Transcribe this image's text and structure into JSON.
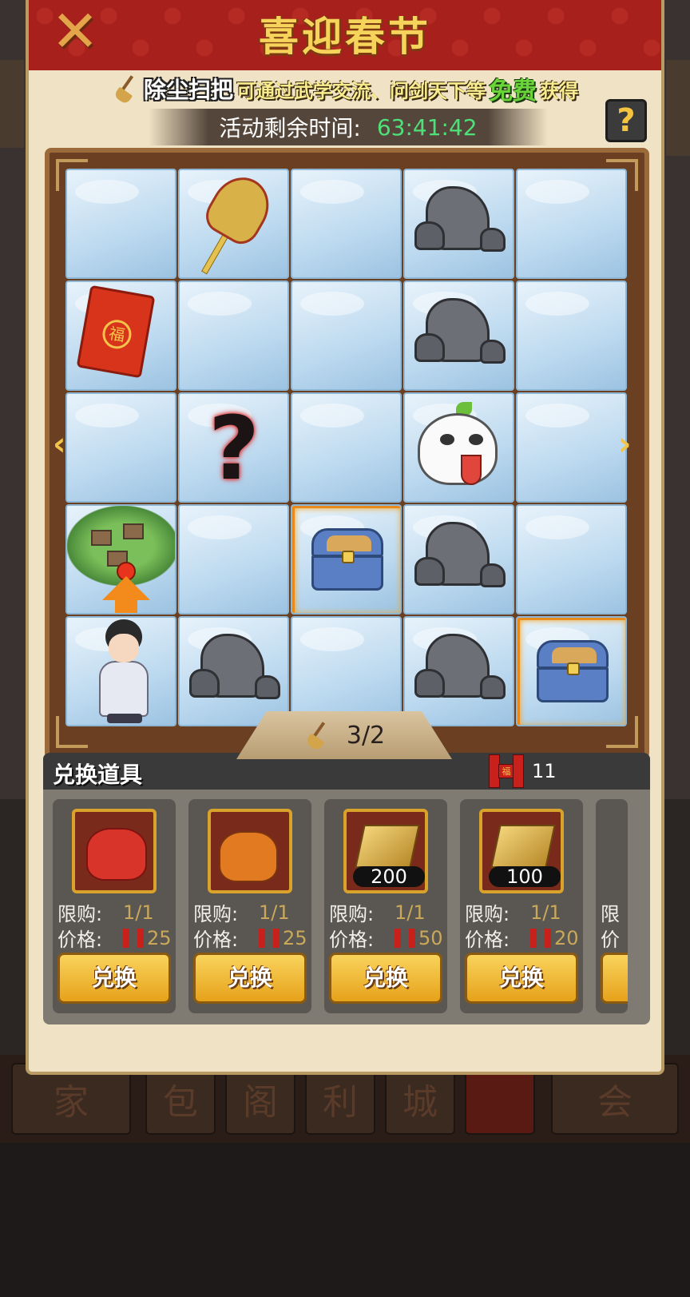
{
  "title": "喜迎春节",
  "broom_hint": {
    "item_name": "除尘扫把",
    "description": "可通过武学交流、问剑天下等",
    "free": "免费",
    "obtain": "获得"
  },
  "timer": {
    "label": "活动剩余时间:",
    "value": "63:41:42"
  },
  "help_label": "?",
  "grid": [
    [
      "empty",
      "broom",
      "empty",
      "rock",
      "empty"
    ],
    [
      "red-envelope",
      "empty",
      "empty",
      "rock",
      "empty"
    ],
    [
      "empty",
      "mystery",
      "empty",
      "ghost",
      "empty"
    ],
    [
      "village",
      "empty",
      "chest",
      "rock",
      "empty"
    ],
    [
      "hero",
      "rock",
      "empty",
      "rock",
      "chest"
    ]
  ],
  "envelope_char": "福",
  "mystery_char": "?",
  "progress": "3/2",
  "shop": {
    "title": "兑换道具",
    "currency_count": "11",
    "limit_label": "限购:",
    "price_label": "价格:",
    "button_label": "兑换",
    "items": [
      {
        "thumb": "red-gift-bag",
        "badge": "",
        "limit": "1/1",
        "price": "25"
      },
      {
        "thumb": "orange-gift-bag",
        "badge": "",
        "limit": "1/1",
        "price": "25"
      },
      {
        "thumb": "gold-bar",
        "badge": "200",
        "limit": "1/1",
        "price": "50"
      },
      {
        "thumb": "gold-bar",
        "badge": "100",
        "limit": "1/1",
        "price": "20"
      }
    ],
    "partial_limit": "限",
    "partial_price": "价"
  },
  "bg_nav": [
    "家",
    "包",
    "阁",
    "利",
    "城",
    "",
    "会"
  ]
}
